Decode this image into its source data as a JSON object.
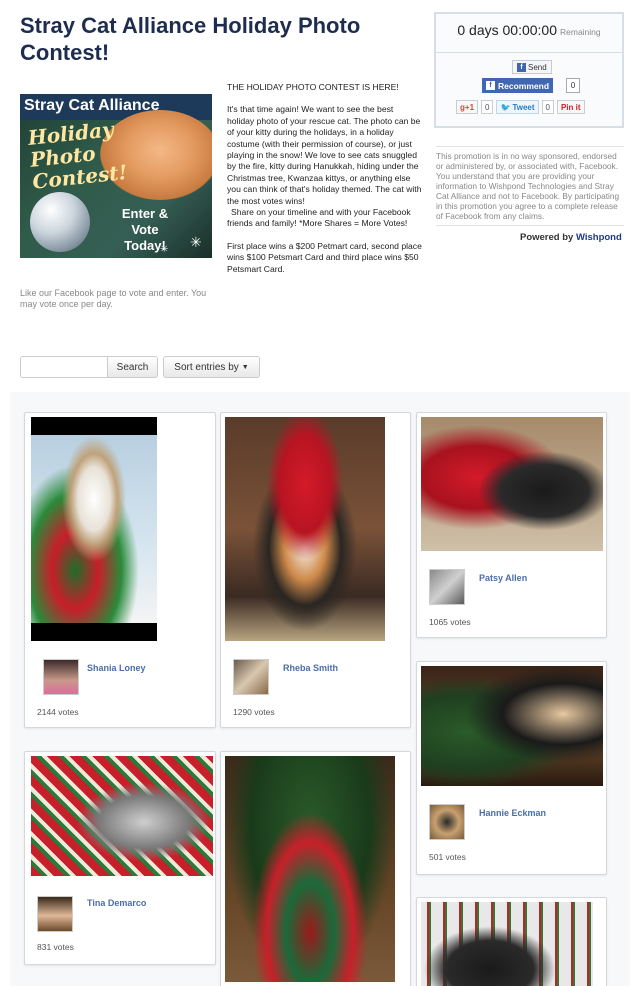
{
  "header": {
    "title": "Stray Cat Alliance Holiday Photo Contest!"
  },
  "banner": {
    "top_text": "Stray Cat Alliance",
    "script_lines": [
      "Holiday",
      "Photo",
      "Contest!"
    ],
    "enter_vote": "Enter & Vote Today!"
  },
  "left_note": "Like our Facebook page to vote and enter. You may vote once per day.",
  "description": {
    "heading": "THE HOLIDAY PHOTO CONTEST IS HERE!",
    "p1": "It's that time again! We want to see the best holiday photo of your rescue cat. The photo can be of your kitty during the holidays, in a holiday costume (with their permission of course), or just playing in the snow! We love to see cats snuggled by the fire, kitty during Hanukkah, hiding under the Christmas tree, Kwanzaa kittys, or anything else you can think of that's holiday themed. The cat with the most votes wins!",
    "p2": "Share on your timeline and with your Facebook friends and family! *More Shares = More Votes!",
    "p3": "First place wins a $200 Petmart card, second place wins $100 Petsmart Card and third place wins $50 Petsmart Card."
  },
  "countdown": {
    "value": "0 days 00:00:00",
    "suffix": "Remaining"
  },
  "social": {
    "send_label": "Send",
    "recommend_label": "Recommend",
    "recommend_count": "0",
    "gplus_label": "+1",
    "gplus_count": "0",
    "tweet_label": "Tweet",
    "tweet_count": "0",
    "pin_label": "Pin it"
  },
  "disclaimer": "This promotion is in no way sponsored, endorsed or administered by, or associated with, Facebook. You understand that you are providing your information to Wishpond Technologies and Stray Cat Alliance and not to Facebook. By participating in this promotion you agree to a complete release of Facebook from any claims.",
  "powered": {
    "prefix": "Powered by",
    "brand": "Wishpond"
  },
  "search": {
    "placeholder": "",
    "button_label": "Search",
    "sort_label": "Sort entries by"
  },
  "entries": [
    {
      "name": "Shania Loney",
      "votes": "2144 votes"
    },
    {
      "name": "Rheba Smith",
      "votes": "1290 votes"
    },
    {
      "name": "Patsy Allen",
      "votes": "1065 votes"
    },
    {
      "name": "Hannie Eckman",
      "votes": "501 votes"
    },
    {
      "name": "Tina Demarco",
      "votes": "831 votes"
    }
  ],
  "colors": {
    "title": "#1e2d4f",
    "link_name": "#4a6ea9",
    "facebook_blue": "#4267b2"
  }
}
